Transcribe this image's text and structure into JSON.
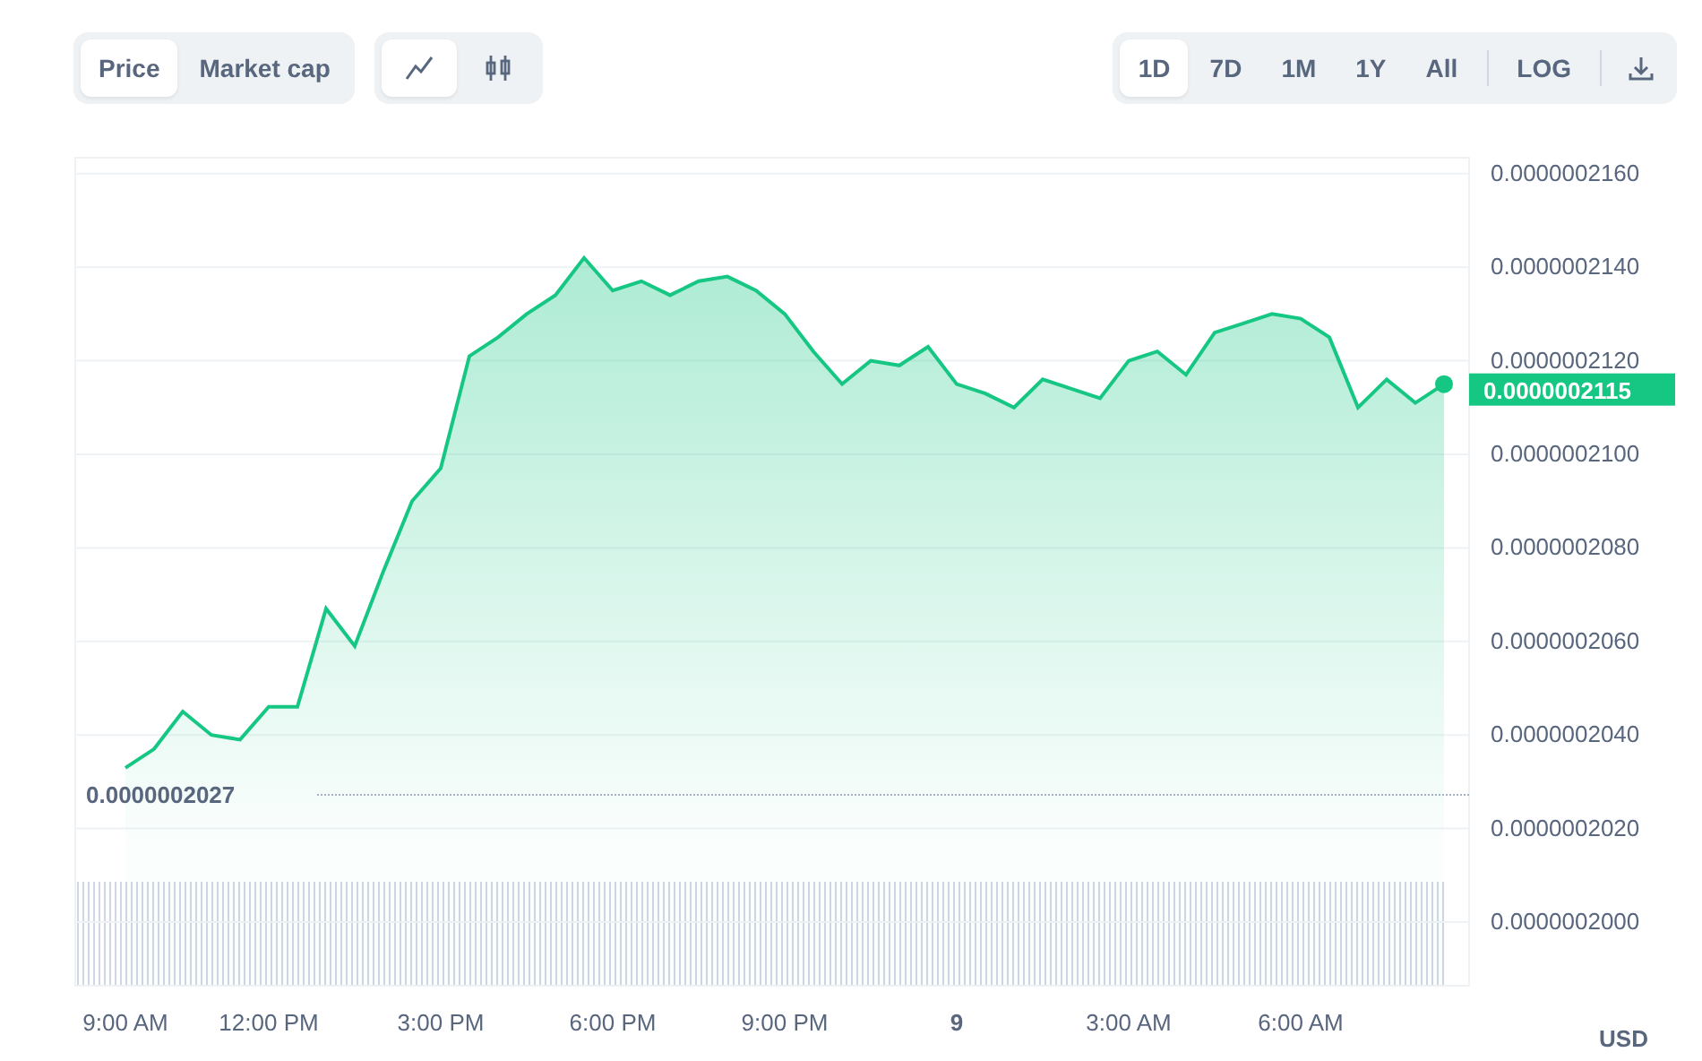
{
  "toolbar": {
    "views": [
      {
        "label": "Price",
        "selected": true
      },
      {
        "label": "Market cap",
        "selected": false
      }
    ],
    "chart_types": [
      {
        "kind": "line",
        "selected": true
      },
      {
        "kind": "candles",
        "selected": false
      }
    ],
    "ranges": [
      {
        "label": "1D",
        "selected": true
      },
      {
        "label": "7D",
        "selected": false
      },
      {
        "label": "1M",
        "selected": false
      },
      {
        "label": "1Y",
        "selected": false
      },
      {
        "label": "All",
        "selected": false
      }
    ],
    "log": {
      "label": "LOG",
      "selected": false
    }
  },
  "chart": {
    "reference_price": "0.0000002027",
    "last_price": "0.0000002115",
    "currency": "USD",
    "chart_data": {
      "type": "area",
      "grid": true,
      "categories": [
        "9:00 AM",
        null,
        null,
        null,
        null,
        "12:00 PM",
        null,
        null,
        null,
        null,
        null,
        "3:00 PM",
        null,
        null,
        null,
        null,
        null,
        "6:00 PM",
        null,
        null,
        null,
        null,
        null,
        "9:00 PM",
        null,
        null,
        null,
        null,
        null,
        "9",
        null,
        null,
        null,
        null,
        null,
        "3:00 AM",
        null,
        null,
        null,
        null,
        null,
        "6:00 AM",
        null,
        null,
        null,
        null,
        null
      ],
      "series": [
        {
          "color": "#16c784",
          "values": [
            2.033e-07,
            2.037e-07,
            2.045e-07,
            2.04e-07,
            2.039e-07,
            2.046e-07,
            2.046e-07,
            2.067e-07,
            2.059e-07,
            2.075e-07,
            2.09e-07,
            2.097e-07,
            2.121e-07,
            2.125e-07,
            2.13e-07,
            2.134e-07,
            2.142e-07,
            2.135e-07,
            2.137e-07,
            2.134e-07,
            2.137e-07,
            2.138e-07,
            2.135e-07,
            2.13e-07,
            2.122e-07,
            2.115e-07,
            2.12e-07,
            2.119e-07,
            2.123e-07,
            2.115e-07,
            2.113e-07,
            2.11e-07,
            2.116e-07,
            2.114e-07,
            2.112e-07,
            2.12e-07,
            2.122e-07,
            2.117e-07,
            2.126e-07,
            2.128e-07,
            2.13e-07,
            2.129e-07,
            2.125e-07,
            2.11e-07,
            2.116e-07,
            2.111e-07,
            2.115e-07
          ]
        }
      ],
      "ylim": [
        1.9864e-07,
        2.1634e-07
      ],
      "yticks": [
        {
          "value": 2e-07,
          "label": "0.0000002000"
        },
        {
          "value": 2.02e-07,
          "label": "0.0000002020"
        },
        {
          "value": 2.04e-07,
          "label": "0.0000002040"
        },
        {
          "value": 2.06e-07,
          "label": "0.0000002060"
        },
        {
          "value": 2.08e-07,
          "label": "0.0000002080"
        },
        {
          "value": 2.1e-07,
          "label": "0.0000002100"
        },
        {
          "value": 2.12e-07,
          "label": "0.0000002120"
        },
        {
          "value": 2.14e-07,
          "label": "0.0000002140"
        },
        {
          "value": 2.16e-07,
          "label": "0.0000002160"
        }
      ]
    }
  }
}
